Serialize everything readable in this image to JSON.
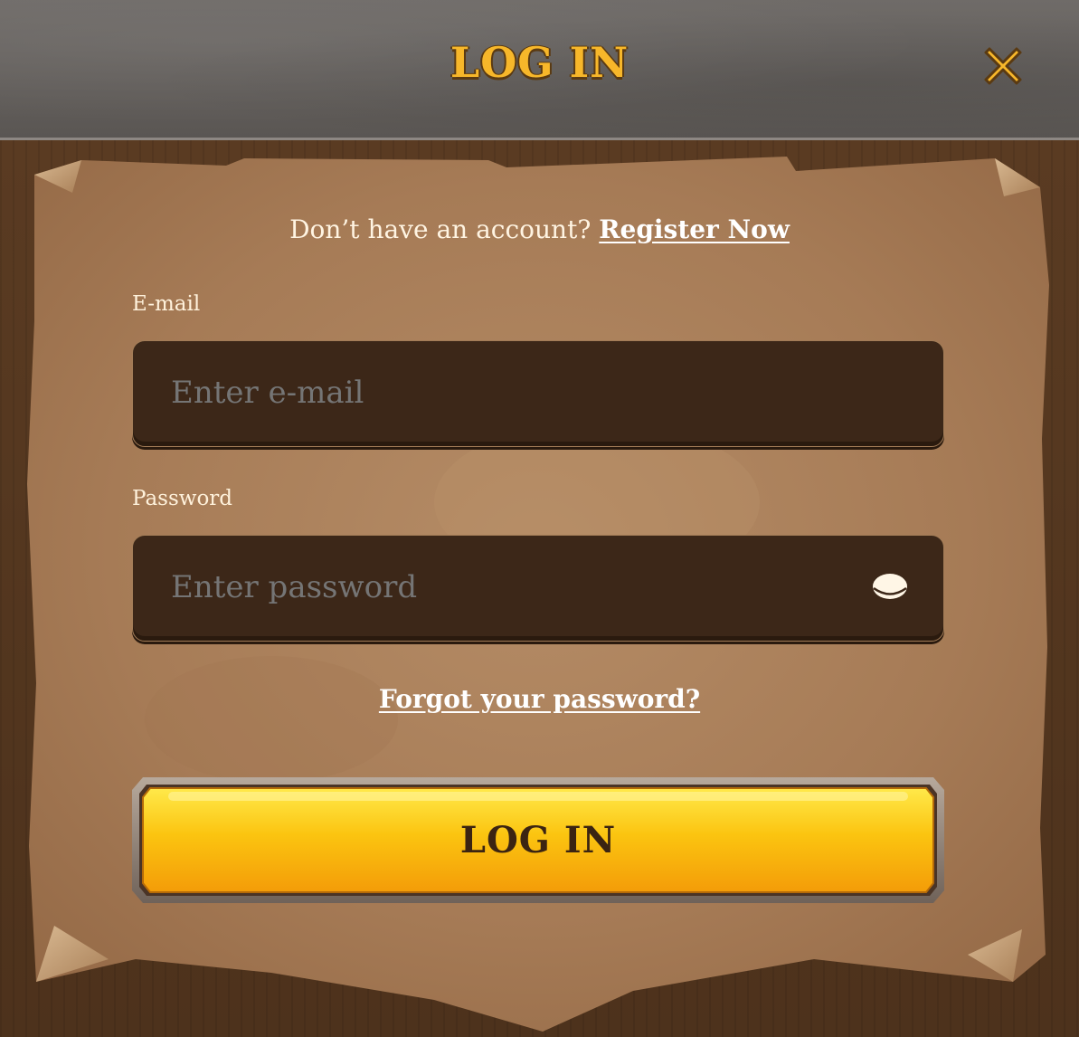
{
  "dialog": {
    "title": "LOG IN",
    "close_icon": "close-icon"
  },
  "signup": {
    "prompt": "Don’t have an account?",
    "register_label": "Register Now"
  },
  "form": {
    "email": {
      "label": "E-mail",
      "placeholder": "Enter e-mail",
      "value": ""
    },
    "password": {
      "label": "Password",
      "placeholder": "Enter password",
      "value": "",
      "toggle_icon": "eye-icon"
    },
    "forgot_label": "Forgot your password?",
    "submit_label": "LOG IN"
  },
  "colors": {
    "title_gold": "#f7b72a",
    "parchment": "#a87c58",
    "input_bg": "#3c2718",
    "button_yellow": "#fbc410",
    "stone_header": "#67635f"
  }
}
